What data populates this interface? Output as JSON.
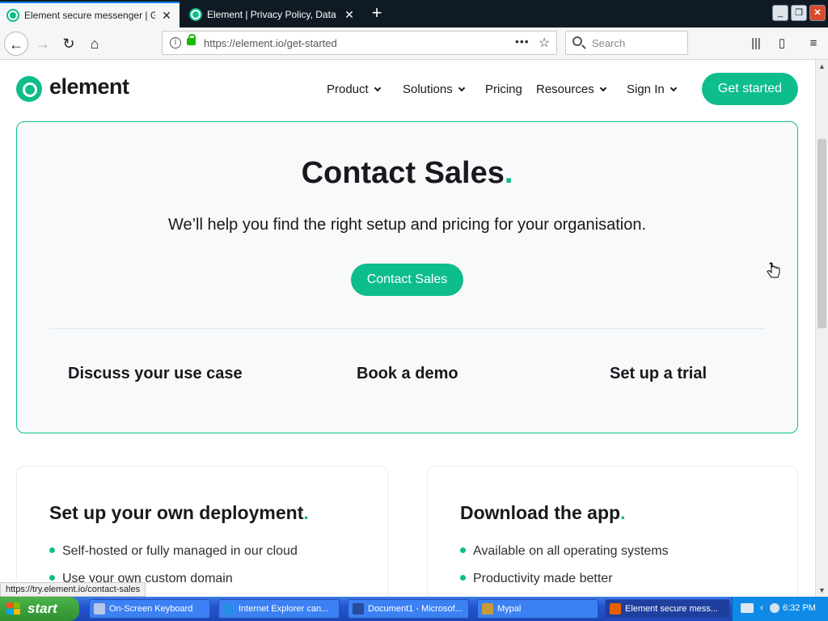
{
  "browser": {
    "tabs": [
      {
        "title": "Element secure messenger | Get s",
        "active": true
      },
      {
        "title": "Element | Privacy Policy, Data Pro",
        "active": false
      }
    ],
    "url": "https://element.io/get-started",
    "search_placeholder": "Search",
    "status_link": "https://try.element.io/contact-sales",
    "accent_color": "#0a84ff"
  },
  "site": {
    "brand": "element",
    "brand_color": "#0dbd8b",
    "nav": [
      {
        "label": "Product",
        "has_dropdown": true
      },
      {
        "label": "Solutions",
        "has_dropdown": true
      },
      {
        "label": "Pricing",
        "has_dropdown": false
      },
      {
        "label": "Resources",
        "has_dropdown": true
      },
      {
        "label": "Sign In",
        "has_dropdown": true
      }
    ],
    "cta": "Get started"
  },
  "contact": {
    "title": "Contact Sales",
    "title_dot": ".",
    "subtitle": "We’ll help you find the right setup and pricing for your organisation.",
    "button": "Contact Sales",
    "options": [
      "Discuss your use case",
      "Book a demo",
      "Set up a trial"
    ]
  },
  "cards": [
    {
      "title": "Set up your own deployment",
      "dot": ".",
      "bullets": [
        "Self-hosted or fully managed in our cloud",
        "Use your own custom domain"
      ]
    },
    {
      "title": "Download the app",
      "dot": ".",
      "bullets": [
        "Available on all operating systems",
        "Productivity made better"
      ]
    }
  ],
  "taskbar": {
    "start": "start",
    "items": [
      {
        "label": "On-Screen Keyboard",
        "icon": "keyboard-icon"
      },
      {
        "label": "Internet Explorer can...",
        "icon": "ie-icon"
      },
      {
        "label": "Document1 - Microsof...",
        "icon": "word-icon"
      },
      {
        "label": "Mypal",
        "icon": "mypal-icon"
      },
      {
        "label": "Element secure mess...",
        "icon": "firefox-icon",
        "active": true
      }
    ],
    "clock": "6:32 PM"
  }
}
